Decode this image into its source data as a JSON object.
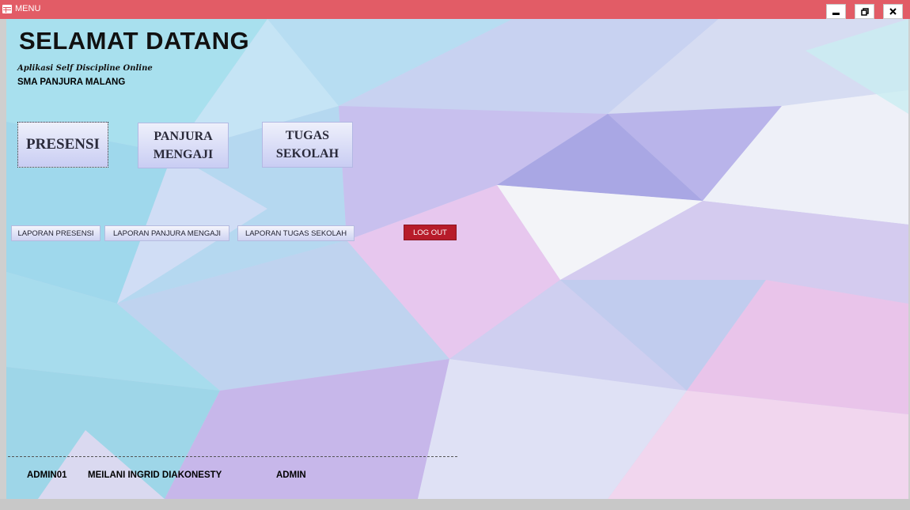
{
  "window": {
    "title": "MENU",
    "accent_color": "#e25c66",
    "controls": [
      "minimize-icon",
      "restore-icon",
      "close-icon"
    ]
  },
  "header": {
    "heading": "SELAMAT DATANG",
    "subtitle": "Aplikasi Self Discipline Online",
    "school": "SMA PANJURA MALANG"
  },
  "main_buttons": {
    "presensi": "PRESENSI",
    "mengaji": "PANJURA\nMENGAJI",
    "tugas": "TUGAS\nSEKOLAH"
  },
  "report_buttons": {
    "presensi": "LAPORAN PRESENSI",
    "mengaji": "LAPORAN PANJURA MENGAJI",
    "tugas": "LAPORAN TUGAS SEKOLAH"
  },
  "logout": {
    "label": "LOG OUT",
    "color": "#b71c2a"
  },
  "footer": {
    "user_id": "ADMIN01",
    "user_name": "MEILANI INGRID DIAKONESTY",
    "role": "ADMIN"
  }
}
